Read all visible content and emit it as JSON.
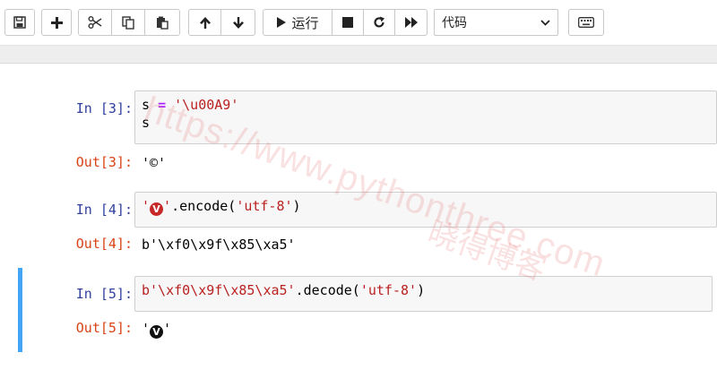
{
  "toolbar": {
    "run_label": "运行",
    "cell_type_selected": "代码",
    "buttons": [
      "save-icon",
      "plus-icon",
      "scissors-icon",
      "copy-icon",
      "paste-icon",
      "arrow-up-icon",
      "arrow-down-icon",
      "play-icon",
      "stop-icon",
      "restart-icon",
      "fast-forward-icon",
      "keyboard-icon"
    ]
  },
  "cells": [
    {
      "in_prompt": "In [3]:",
      "code_line1_var": "s",
      "code_line1_op": "=",
      "code_line1_str": "'\\u00A9'",
      "code_line2": "s",
      "out_prompt": "Out[3]:",
      "output": "'©'"
    },
    {
      "in_prompt": "In [4]:",
      "code_str_open": "'",
      "code_emoji": "V",
      "code_str_close": "'",
      "code_method": ".encode(",
      "code_arg": "'utf-8'",
      "code_close": ")",
      "out_prompt": "Out[4]:",
      "output": "b'\\xf0\\x9f\\x85\\xa5'"
    },
    {
      "in_prompt": "In [5]:",
      "code_bytes": "b'\\xf0\\x9f\\x85\\xa5'",
      "code_method": ".decode(",
      "code_arg": "'utf-8'",
      "code_close": ")",
      "out_prompt": "Out[5]:",
      "output_open": "'",
      "output_emoji": "V",
      "output_close": "'"
    }
  ],
  "watermark": {
    "url": "https://www.pythonthree.com",
    "name": "晓得博客"
  }
}
